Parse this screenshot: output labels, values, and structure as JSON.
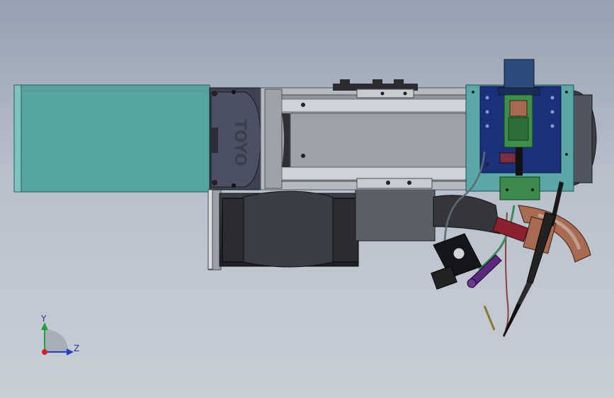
{
  "model": {
    "actuator_logo": "TOYO"
  },
  "triad": {
    "y_label": "Y",
    "z_label": "Z"
  },
  "colors": {
    "motor_cover": "#55a59f",
    "background_top": "#96a0b0",
    "background_bottom": "#c8ced6",
    "bracket_blue": "#1c2f7a",
    "teal_plate": "#5aa8a6",
    "copper_part": "#a86a50",
    "green_board": "#3d8a4c"
  }
}
